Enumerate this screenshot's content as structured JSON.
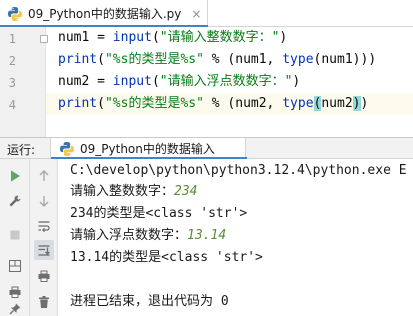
{
  "editor_tab": {
    "label": "09_Python中的数据输入.py",
    "close": "×"
  },
  "editor": {
    "lines": [
      {
        "num": "1",
        "parts": [
          "num1 = ",
          "input",
          "(",
          "\"请输入整数数字：\"",
          ")"
        ]
      },
      {
        "num": "2",
        "parts": [
          "print",
          "(",
          "\"%s的类型是%s\"",
          " % (num1, ",
          "type",
          "(num1)))"
        ]
      },
      {
        "num": "3",
        "parts": [
          "num2 = ",
          "input",
          "(",
          "\"请输入浮点数数字：\"",
          ")"
        ]
      },
      {
        "num": "4",
        "parts": [
          "print",
          "(",
          "\"%s的类型是%s\"",
          " % (num2, ",
          "type",
          "(",
          "num2",
          ")",
          ")"
        ]
      }
    ]
  },
  "run_window": {
    "label": "运行:",
    "tab_label": "09_Python中的数据输入"
  },
  "console": {
    "lines": [
      {
        "text": "C:\\develop\\python\\python3.12.4\\python.exe E"
      },
      {
        "prompt": "请输入整数数字：",
        "input": "234"
      },
      {
        "text": "234的类型是<class 'str'>"
      },
      {
        "prompt": "请输入浮点数数字：",
        "input": "13.14"
      },
      {
        "text": "13.14的类型是<class 'str'>"
      },
      {
        "text": ""
      },
      {
        "text": "进程已结束，退出代码为 0"
      }
    ]
  },
  "colors": {
    "accent": "#4083c9",
    "string": "#067d17",
    "builtin": "#0033b3",
    "user_input": "#5a8d36",
    "brace_match": "#93d9d9"
  },
  "icons": {
    "toolstrip_left": [
      "run-icon",
      "wrench-icon",
      "stop-icon",
      "layout-icon",
      "print-icon",
      "pin-icon"
    ],
    "toolstrip_right": [
      "up-arrow-icon",
      "down-arrow-icon",
      "soft-wrap-icon",
      "scroll-to-end-icon",
      "print-icon",
      "trash-icon"
    ]
  }
}
